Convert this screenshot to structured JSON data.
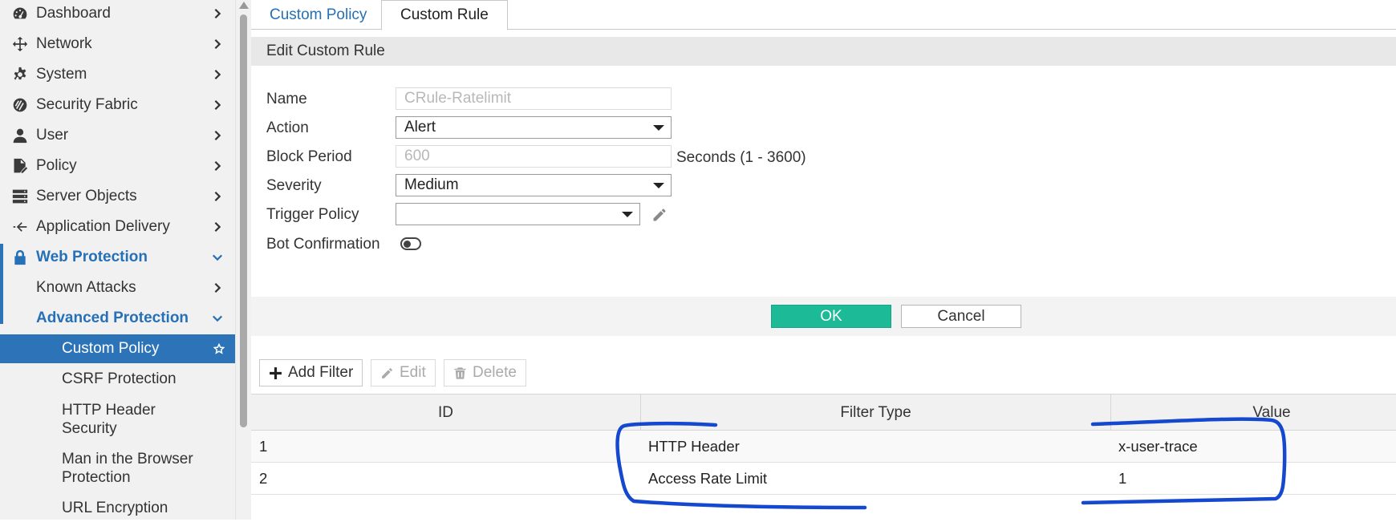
{
  "sidebar": {
    "items": [
      {
        "label": "Dashboard"
      },
      {
        "label": "Network"
      },
      {
        "label": "System"
      },
      {
        "label": "Security Fabric"
      },
      {
        "label": "User"
      },
      {
        "label": "Policy"
      },
      {
        "label": "Server Objects"
      },
      {
        "label": "Application Delivery"
      },
      {
        "label": "Web Protection"
      },
      {
        "label": "Known Attacks"
      },
      {
        "label": "Advanced Protection"
      },
      {
        "label": "Custom Policy"
      },
      {
        "label": "CSRF Protection"
      },
      {
        "label": "HTTP Header",
        "label2": "Security"
      },
      {
        "label": "Man in the Browser",
        "label2": "Protection"
      },
      {
        "label": "URL Encryption"
      }
    ]
  },
  "tabs": [
    {
      "label": "Custom Policy"
    },
    {
      "label": "Custom Rule"
    }
  ],
  "panel": {
    "title": "Edit Custom Rule"
  },
  "form": {
    "name_label": "Name",
    "name_value": "CRule-Ratelimit",
    "action_label": "Action",
    "action_value": "Alert",
    "block_period_label": "Block Period",
    "block_period_value": "600",
    "block_period_hint": "Seconds (1 - 3600)",
    "severity_label": "Severity",
    "severity_value": "Medium",
    "trigger_label": "Trigger Policy",
    "trigger_value": "",
    "bot_label": "Bot Confirmation"
  },
  "buttons": {
    "ok": "OK",
    "cancel": "Cancel"
  },
  "toolbar": {
    "add": "Add Filter",
    "edit": "Edit",
    "delete": "Delete"
  },
  "table": {
    "headers": [
      "ID",
      "Filter Type",
      "Value"
    ],
    "rows": [
      [
        "1",
        "HTTP Header",
        "x-user-trace"
      ],
      [
        "2",
        "Access Rate Limit",
        "1"
      ]
    ]
  },
  "colors": {
    "accent": "#2670b6",
    "active_nav": "#2c73b8",
    "ok_button": "#1dba98",
    "annotation": "#1448cf"
  }
}
